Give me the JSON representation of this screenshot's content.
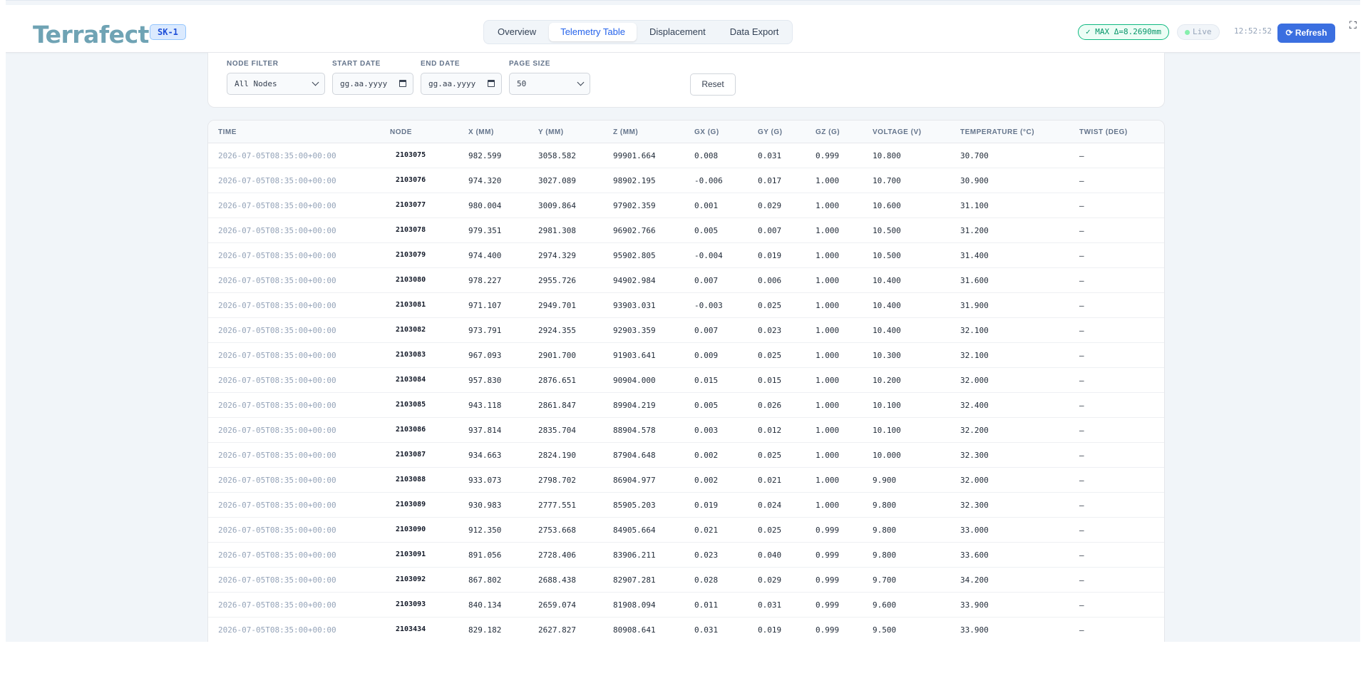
{
  "header": {
    "logo": "Terrafect",
    "site": "SK-1",
    "tabs": [
      "Overview",
      "Telemetry Table",
      "Displacement",
      "Data Export"
    ],
    "active_tab": "Telemetry Table",
    "max_badge": "✓ MAX Δ=8.2690mm",
    "live": "Live",
    "clock": "12:52:52",
    "refresh": "⟳ Refresh",
    "fullscreen_icon": "exit-fullscreen-icon"
  },
  "filters": {
    "node_filter": {
      "label": "NODE FILTER",
      "value": "All Nodes"
    },
    "start_date": {
      "label": "START DATE",
      "value": "gg.aa.yyyy"
    },
    "end_date": {
      "label": "END DATE",
      "value": "gg.aa.yyyy"
    },
    "page_size": {
      "label": "PAGE SIZE",
      "value": "50"
    },
    "reset": "Reset"
  },
  "table": {
    "headers": [
      "TIME",
      "NODE",
      "X (MM)",
      "Y (MM)",
      "Z (MM)",
      "GX (G)",
      "GY (G)",
      "GZ (G)",
      "VOLTAGE (V)",
      "TEMPERATURE (°C)",
      "TWIST (DEG)"
    ],
    "rows": [
      [
        "2026-07-05T08:35:00+00:00",
        "2103075",
        "982.599",
        "3058.582",
        "99901.664",
        "0.008",
        "0.031",
        "0.999",
        "10.800",
        "30.700",
        "—"
      ],
      [
        "2026-07-05T08:35:00+00:00",
        "2103076",
        "974.320",
        "3027.089",
        "98902.195",
        "-0.006",
        "0.017",
        "1.000",
        "10.700",
        "30.900",
        "—"
      ],
      [
        "2026-07-05T08:35:00+00:00",
        "2103077",
        "980.004",
        "3009.864",
        "97902.359",
        "0.001",
        "0.029",
        "1.000",
        "10.600",
        "31.100",
        "—"
      ],
      [
        "2026-07-05T08:35:00+00:00",
        "2103078",
        "979.351",
        "2981.308",
        "96902.766",
        "0.005",
        "0.007",
        "1.000",
        "10.500",
        "31.200",
        "—"
      ],
      [
        "2026-07-05T08:35:00+00:00",
        "2103079",
        "974.400",
        "2974.329",
        "95902.805",
        "-0.004",
        "0.019",
        "1.000",
        "10.500",
        "31.400",
        "—"
      ],
      [
        "2026-07-05T08:35:00+00:00",
        "2103080",
        "978.227",
        "2955.726",
        "94902.984",
        "0.007",
        "0.006",
        "1.000",
        "10.400",
        "31.600",
        "—"
      ],
      [
        "2026-07-05T08:35:00+00:00",
        "2103081",
        "971.107",
        "2949.701",
        "93903.031",
        "-0.003",
        "0.025",
        "1.000",
        "10.400",
        "31.900",
        "—"
      ],
      [
        "2026-07-05T08:35:00+00:00",
        "2103082",
        "973.791",
        "2924.355",
        "92903.359",
        "0.007",
        "0.023",
        "1.000",
        "10.400",
        "32.100",
        "—"
      ],
      [
        "2026-07-05T08:35:00+00:00",
        "2103083",
        "967.093",
        "2901.700",
        "91903.641",
        "0.009",
        "0.025",
        "1.000",
        "10.300",
        "32.100",
        "—"
      ],
      [
        "2026-07-05T08:35:00+00:00",
        "2103084",
        "957.830",
        "2876.651",
        "90904.000",
        "0.015",
        "0.015",
        "1.000",
        "10.200",
        "32.000",
        "—"
      ],
      [
        "2026-07-05T08:35:00+00:00",
        "2103085",
        "943.118",
        "2861.847",
        "89904.219",
        "0.005",
        "0.026",
        "1.000",
        "10.100",
        "32.400",
        "—"
      ],
      [
        "2026-07-05T08:35:00+00:00",
        "2103086",
        "937.814",
        "2835.704",
        "88904.578",
        "0.003",
        "0.012",
        "1.000",
        "10.100",
        "32.200",
        "—"
      ],
      [
        "2026-07-05T08:35:00+00:00",
        "2103087",
        "934.663",
        "2824.190",
        "87904.648",
        "0.002",
        "0.025",
        "1.000",
        "10.000",
        "32.300",
        "—"
      ],
      [
        "2026-07-05T08:35:00+00:00",
        "2103088",
        "933.073",
        "2798.702",
        "86904.977",
        "0.002",
        "0.021",
        "1.000",
        "9.900",
        "32.000",
        "—"
      ],
      [
        "2026-07-05T08:35:00+00:00",
        "2103089",
        "930.983",
        "2777.551",
        "85905.203",
        "0.019",
        "0.024",
        "1.000",
        "9.800",
        "32.300",
        "—"
      ],
      [
        "2026-07-05T08:35:00+00:00",
        "2103090",
        "912.350",
        "2753.668",
        "84905.664",
        "0.021",
        "0.025",
        "0.999",
        "9.800",
        "33.000",
        "—"
      ],
      [
        "2026-07-05T08:35:00+00:00",
        "2103091",
        "891.056",
        "2728.406",
        "83906.211",
        "0.023",
        "0.040",
        "0.999",
        "9.800",
        "33.600",
        "—"
      ],
      [
        "2026-07-05T08:35:00+00:00",
        "2103092",
        "867.802",
        "2688.438",
        "82907.281",
        "0.028",
        "0.029",
        "0.999",
        "9.700",
        "34.200",
        "—"
      ],
      [
        "2026-07-05T08:35:00+00:00",
        "2103093",
        "840.134",
        "2659.074",
        "81908.094",
        "0.011",
        "0.031",
        "0.999",
        "9.600",
        "33.900",
        "—"
      ],
      [
        "2026-07-05T08:35:00+00:00",
        "2103434",
        "829.182",
        "2627.827",
        "80908.641",
        "0.031",
        "0.019",
        "0.999",
        "9.500",
        "33.900",
        "—"
      ]
    ]
  }
}
